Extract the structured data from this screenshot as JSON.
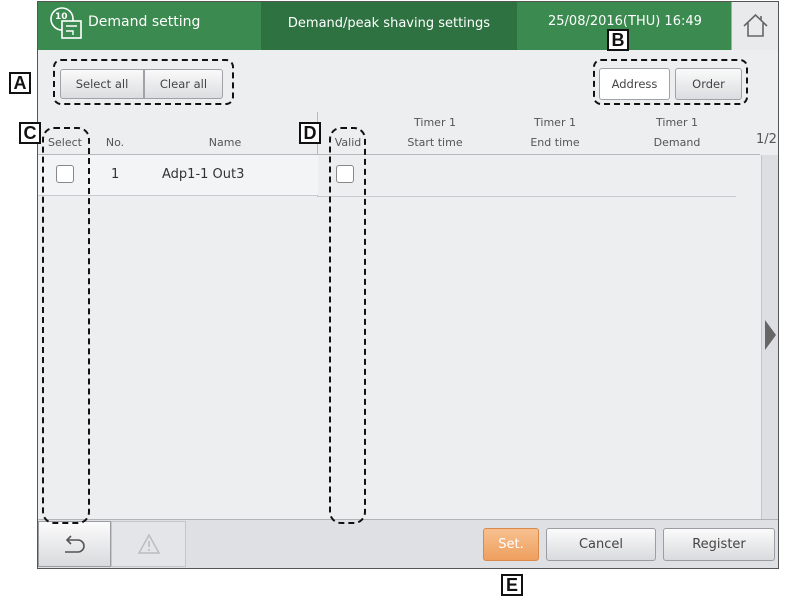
{
  "header": {
    "title": "Demand setting",
    "subtitle": "Demand/peak shaving settings",
    "datetime": "25/08/2016(THU) 16:49",
    "logo_text": "10",
    "home_icon": "home-icon"
  },
  "toolbar": {
    "select_all": "Select all",
    "clear_all": "Clear all",
    "address": "Address",
    "order": "Order"
  },
  "columns": {
    "select": "Select",
    "no": "No.",
    "name": "Name",
    "valid": "Valid",
    "start_time_top": "Timer 1",
    "start_time_bottom": "Start time",
    "end_time_top": "Timer 1",
    "end_time_bottom": "End time",
    "demand_top": "Timer 1",
    "demand_bottom": "Demand"
  },
  "page_indicator": "1/2",
  "rows": [
    {
      "no": "1",
      "name": "Adp1-1 Out3",
      "selected": false,
      "valid": false
    }
  ],
  "footer": {
    "back_icon": "back-arrow-icon",
    "warning_icon": "warning-icon",
    "set": "Set.",
    "cancel": "Cancel",
    "register": "Register"
  },
  "callouts": {
    "a": "A",
    "b": "B",
    "c": "C",
    "d": "D",
    "e": "E"
  },
  "colors": {
    "header_green": "#3b8a4f",
    "header_dark_green": "#2e7242",
    "set_button_orange": "#f2b27a"
  }
}
